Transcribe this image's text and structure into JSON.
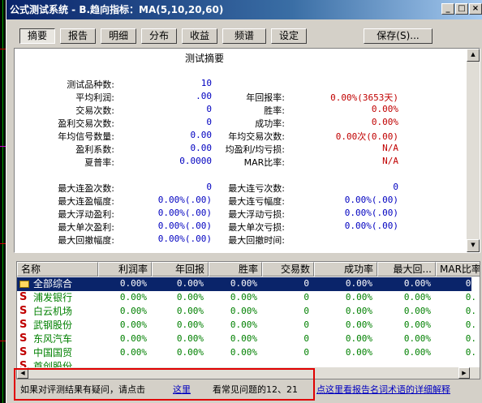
{
  "window": {
    "title": "公式测试系统 - B.趋向指标：MA(5,10,20,60)",
    "controls": [
      "_",
      "□",
      "×"
    ]
  },
  "tabs": [
    "摘要",
    "报告",
    "明细",
    "分布",
    "收益",
    "频谱",
    "设定"
  ],
  "active_tab": "摘要",
  "save_button": "保存(S)...",
  "summary": {
    "title": "测试摘要",
    "left_rows": [
      {
        "label": "测试品种数:",
        "value": "10"
      },
      {
        "label": "平均利润:",
        "value": ".00"
      },
      {
        "label": "交易次数:",
        "value": "0"
      },
      {
        "label": "盈利交易次数:",
        "value": "0"
      },
      {
        "label": "年均信号数量:",
        "value": "0.00"
      },
      {
        "label": "盈利系数:",
        "value": "0.00"
      },
      {
        "label": "夏普率:",
        "value": "0.0000"
      }
    ],
    "right_rows": [
      {
        "label": "年回报率:",
        "value": "0.00%(3653天)"
      },
      {
        "label": "胜率:",
        "value": "0.00%"
      },
      {
        "label": "成功率:",
        "value": "0.00%"
      },
      {
        "label": "年均交易次数:",
        "value": "0.00次(0.00)"
      },
      {
        "label": "均盈利/均亏损:",
        "value": "N/A"
      },
      {
        "label": "MAR比率:",
        "value": "N/A"
      }
    ],
    "left_rows2": [
      {
        "label": "最大连盈次数:",
        "value": "0"
      },
      {
        "label": "最大连盈幅度:",
        "value": "0.00%(.00)"
      },
      {
        "label": "最大浮动盈利:",
        "value": "0.00%(.00)"
      },
      {
        "label": "最大单次盈利:",
        "value": "0.00%(.00)"
      },
      {
        "label": "最大回撤幅度:",
        "value": "0.00%(.00)"
      }
    ],
    "right_rows2": [
      {
        "label": "最大连亏次数:",
        "value": "0"
      },
      {
        "label": "最大连亏幅度:",
        "value": "0.00%(.00)"
      },
      {
        "label": "最大浮动亏损:",
        "value": "0.00%(.00)"
      },
      {
        "label": "最大单次亏损:",
        "value": "0.00%(.00)"
      },
      {
        "label": "最大回撤时间:",
        "value": ""
      }
    ]
  },
  "grid": {
    "headers": [
      "名称",
      "利润率",
      "年回报",
      "胜率",
      "交易数",
      "成功率",
      "最大回...",
      "MAR比率"
    ],
    "rows": [
      {
        "name": "全部综合",
        "values": [
          "0.00%",
          "0.00%",
          "0.00%",
          "0",
          "0.00%",
          "0.00%",
          "0."
        ]
      },
      {
        "name": "浦发银行",
        "values": [
          "0.00%",
          "0.00%",
          "0.00%",
          "0",
          "0.00%",
          "0.00%",
          "0."
        ]
      },
      {
        "name": "白云机场",
        "values": [
          "0.00%",
          "0.00%",
          "0.00%",
          "0",
          "0.00%",
          "0.00%",
          "0."
        ]
      },
      {
        "name": "武钢股份",
        "values": [
          "0.00%",
          "0.00%",
          "0.00%",
          "0",
          "0.00%",
          "0.00%",
          "0."
        ]
      },
      {
        "name": "东风汽车",
        "values": [
          "0.00%",
          "0.00%",
          "0.00%",
          "0",
          "0.00%",
          "0.00%",
          "0."
        ]
      },
      {
        "name": "中国国贸",
        "values": [
          "0.00%",
          "0.00%",
          "0.00%",
          "0",
          "0.00%",
          "0.00%",
          "0."
        ]
      },
      {
        "name": "首创股份",
        "values": [
          "",
          "",
          "",
          "",
          "",
          "",
          ""
        ]
      }
    ]
  },
  "footer": {
    "text1": "如果对评测结果有疑问，请点击",
    "link1": "这里",
    "text2": "看常见问题的12、21",
    "link2": "点这里看报告名词术语的详细解释"
  }
}
